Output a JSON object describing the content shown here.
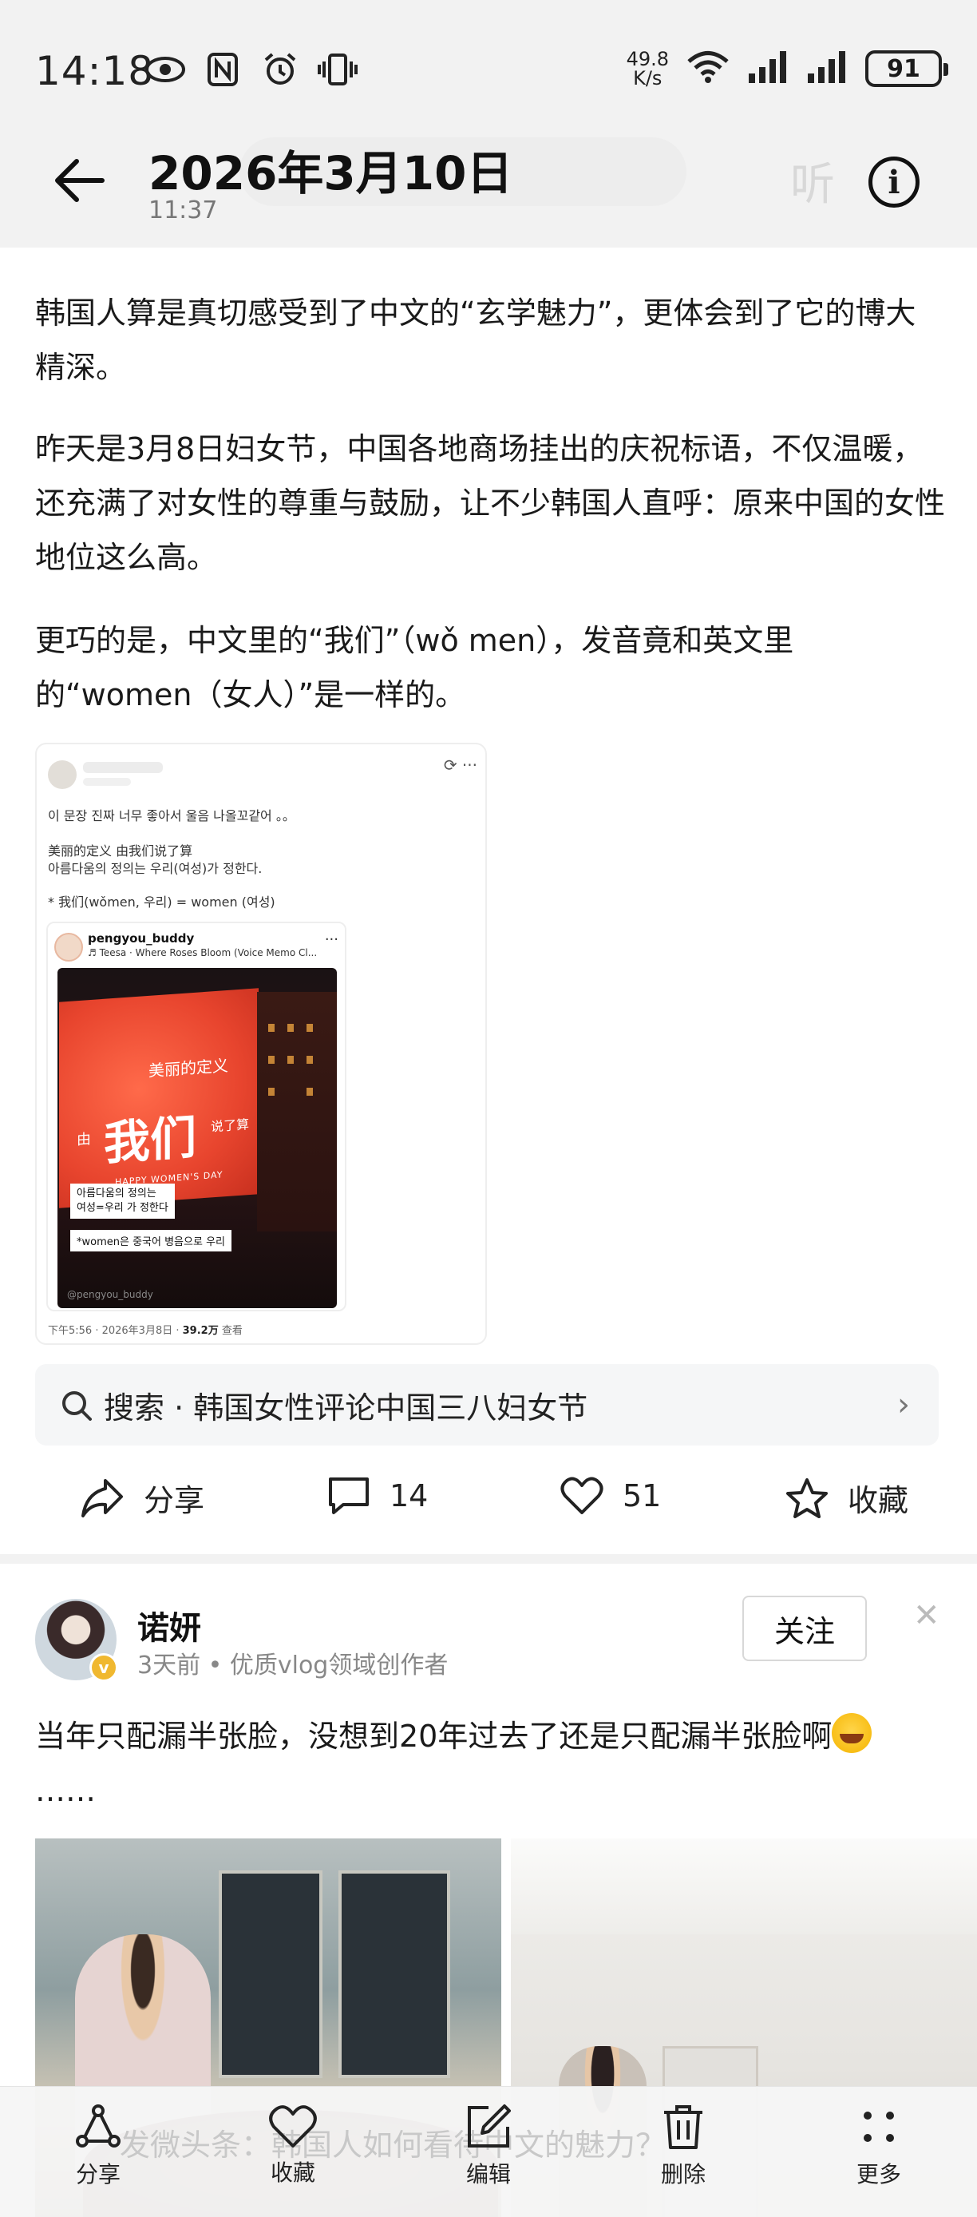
{
  "status_bar": {
    "time": "14:18",
    "net_speed_value": "49.8",
    "net_speed_unit": "K/s",
    "battery": "91",
    "icons": [
      "eye-icon",
      "nfc-icon",
      "alarm-icon",
      "vibrate-icon",
      "wifi-icon",
      "signal-icon",
      "signal-icon",
      "battery-icon"
    ]
  },
  "header": {
    "title": "2026年3月10日",
    "subtitle": "11:37",
    "listen_label": "听"
  },
  "article": {
    "paragraphs": [
      "韩国人算是真切感受到了中文的“玄学魅力”，更体会到了它的博大精深。",
      "昨天是3月8日妇女节，中国各地商场挂出的庆祝标语，不仅温暖，还充满了对女性的尊重与鼓励，让不少韩国人直呼：原来中国的女性地位这么高。",
      "更巧的是，中文里的“我们”（wǒ men），发音竟和英文里的“women（女人）”是一样的。"
    ]
  },
  "embedded_post": {
    "line1": "이 문장 진짜 너무 좋아서 울음 나올꼬같어 。。",
    "line2": "美丽的定义 由我们说了算",
    "line3": "아름다움의 정의는 우리(여성)가 정한다.",
    "line4": "* 我们(wǒmen, 우리) = women (여성)",
    "inner_user": "pengyou_buddy",
    "inner_song": "♬ Teesa · Where Roses Bloom (Voice Memo Cl...",
    "billboard_top": "美丽的定义",
    "billboard_main": "我们",
    "billboard_left": "由",
    "billboard_right": "说了算",
    "billboard_bottom": "HAPPY WOMEN'S DAY",
    "caption1_a": "아름다움의 정의는",
    "caption1_b": "여성=우리 가 정한다",
    "caption2": "*women은 중국어 병음으로 우리",
    "watermark": "@pengyou_buddy",
    "footer_time": "下午5:56 · 2026年3月8日 · ",
    "footer_views": "39.2万",
    "footer_views_suffix": " 查看"
  },
  "search": {
    "label": "搜索 · 韩国女性评论中国三八妇女节"
  },
  "actions": {
    "share": "分享",
    "comment_count": "14",
    "like_count": "51",
    "favorite": "收藏"
  },
  "second_post": {
    "author": "诺妍",
    "meta": "3天前 • 优质vlog领域创作者",
    "follow": "关注",
    "text": "当年只配漏半张脸，没想到20年过去了还是只配漏半张脸啊",
    "text_tail": "……"
  },
  "bottom_bar": {
    "ghost_text": "发微头条：韩国人如何看待中文的魅力？",
    "items": [
      {
        "label": "分享",
        "icon": "share-icon"
      },
      {
        "label": "收藏",
        "icon": "heart-icon"
      },
      {
        "label": "编辑",
        "icon": "edit-icon"
      },
      {
        "label": "删除",
        "icon": "trash-icon"
      },
      {
        "label": "更多",
        "icon": "more-icon"
      }
    ]
  }
}
